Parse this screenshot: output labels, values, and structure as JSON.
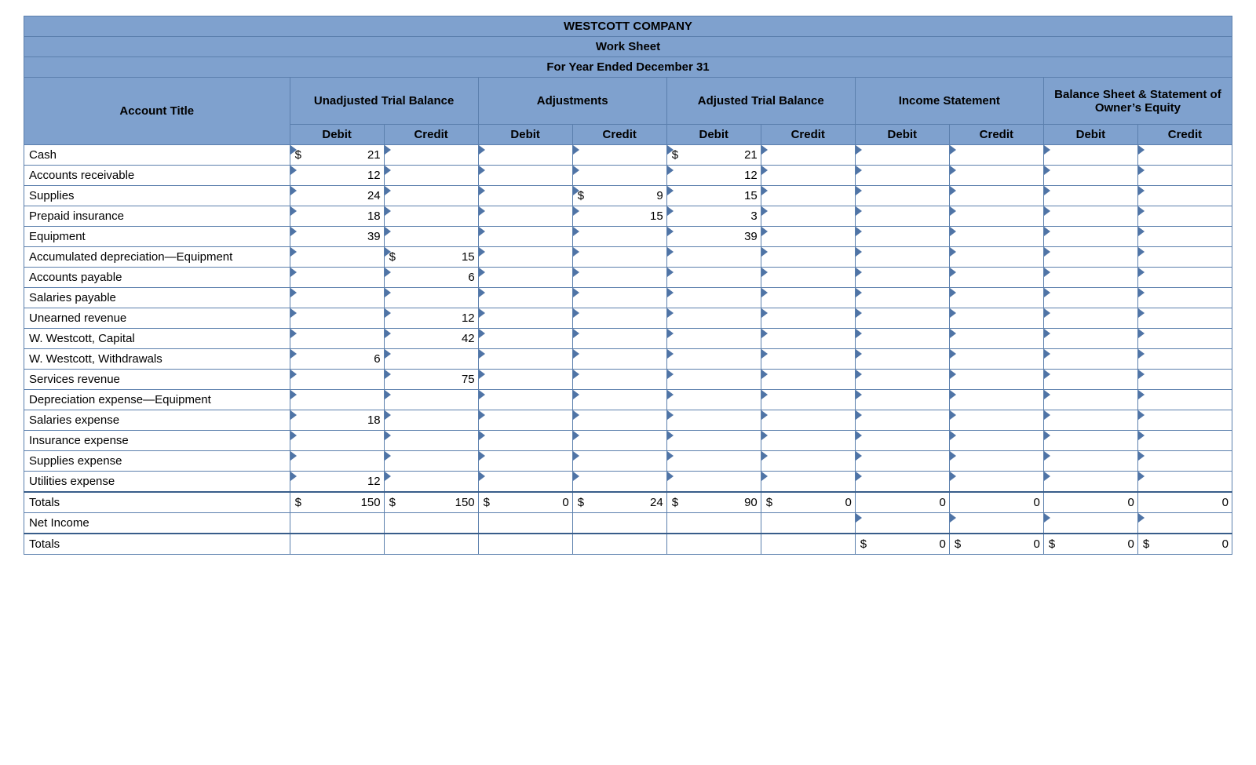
{
  "header": {
    "company": "WESTCOTT COMPANY",
    "title": "Work Sheet",
    "period": "For Year Ended December 31"
  },
  "sections": {
    "account": "Account Title",
    "unadj": "Unadjusted Trial Balance",
    "adjust": "Adjustments",
    "adj": "Adjusted Trial Balance",
    "inc": "Income Statement",
    "bal": "Balance Sheet & Statement of Owner’s Equity",
    "debit": "Debit",
    "credit": "Credit"
  },
  "rows": [
    {
      "title": "Cash",
      "unadj_d": "21",
      "unadj_d$": true,
      "adj_d": "21",
      "adj_d$": true
    },
    {
      "title": "Accounts receivable",
      "unadj_d": "12",
      "adj_d": "12"
    },
    {
      "title": "Supplies",
      "unadj_d": "24",
      "adjust_c": "9",
      "adjust_c$": true,
      "adj_d": "15"
    },
    {
      "title": "Prepaid insurance",
      "unadj_d": "18",
      "adjust_c": "15",
      "adj_d": "3"
    },
    {
      "title": "Equipment",
      "unadj_d": "39",
      "adj_d": "39"
    },
    {
      "title": "Accumulated depreciation—Equipment",
      "unadj_c": "15",
      "unadj_c$": true
    },
    {
      "title": "Accounts payable",
      "unadj_c": "6"
    },
    {
      "title": "Salaries payable"
    },
    {
      "title": "Unearned revenue",
      "unadj_c": "12"
    },
    {
      "title": "W. Westcott, Capital",
      "unadj_c": "42"
    },
    {
      "title": "W. Westcott, Withdrawals",
      "unadj_d": "6"
    },
    {
      "title": "Services revenue",
      "unadj_c": "75"
    },
    {
      "title": "Depreciation expense—Equipment"
    },
    {
      "title": "Salaries expense",
      "unadj_d": "18"
    },
    {
      "title": "Insurance expense"
    },
    {
      "title": "Supplies expense"
    },
    {
      "title": "Utilities expense",
      "unadj_d": "12"
    }
  ],
  "totals1": {
    "title": "Totals",
    "unadj_d": "150",
    "unadj_d$": true,
    "unadj_c": "150",
    "unadj_c$": true,
    "adjust_d": "0",
    "adjust_d$": true,
    "adjust_c": "24",
    "adjust_c$": true,
    "adj_d": "90",
    "adj_d$": true,
    "adj_c": "0",
    "adj_c$": true,
    "inc_d": "0",
    "inc_c": "0",
    "bal_d": "0",
    "bal_c": "0"
  },
  "netincome": {
    "title": "Net Income"
  },
  "totals2": {
    "title": "Totals",
    "inc_d": "0",
    "inc_d$": true,
    "inc_c": "0",
    "inc_c$": true,
    "bal_d": "0",
    "bal_d$": true,
    "bal_c": "0",
    "bal_c$": true
  }
}
